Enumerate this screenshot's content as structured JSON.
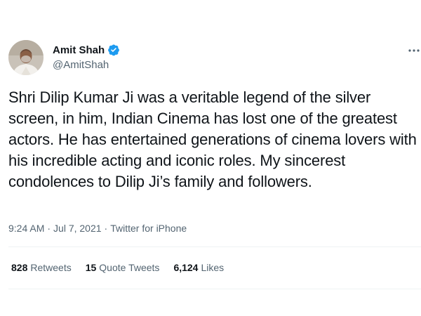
{
  "author": {
    "name": "Amit Shah",
    "handle": "@AmitShah",
    "verified": true,
    "verified_color": "#1d9bf0"
  },
  "tweet": {
    "text": "Shri Dilip Kumar Ji was a veritable legend of the silver screen, in him, Indian Cinema has lost one of the greatest actors. He has entertained generations of cinema lovers with his incredible acting and iconic roles. My sincerest condolences to Dilip Ji’s family and followers.",
    "time": "9:24 AM",
    "date": "Jul 7, 2021",
    "source": "Twitter for iPhone",
    "separator": "·"
  },
  "stats": {
    "retweets_count": "828",
    "retweets_label": "Retweets",
    "quote_count": "15",
    "quote_label": "Quote Tweets",
    "likes_count": "6,124",
    "likes_label": "Likes"
  },
  "icons": {
    "more": "more-horizontal-icon",
    "verified": "verified-badge-icon"
  },
  "colors": {
    "text_primary": "#0f1419",
    "text_secondary": "#536471",
    "divider": "#eff3f4"
  }
}
